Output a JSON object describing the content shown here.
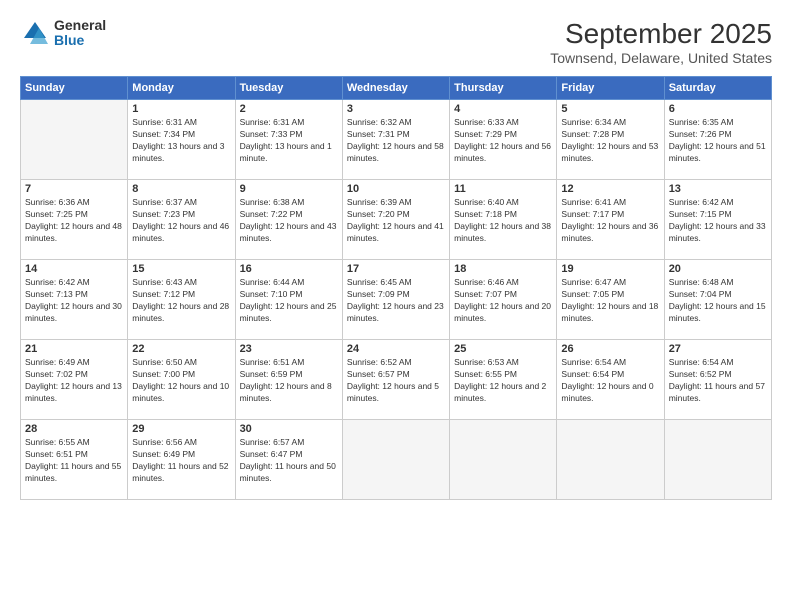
{
  "header": {
    "logo": {
      "general": "General",
      "blue": "Blue"
    },
    "title": "September 2025",
    "location": "Townsend, Delaware, United States"
  },
  "weekdays": [
    "Sunday",
    "Monday",
    "Tuesday",
    "Wednesday",
    "Thursday",
    "Friday",
    "Saturday"
  ],
  "weeks": [
    [
      {
        "day": "",
        "empty": true
      },
      {
        "day": "1",
        "sunrise": "Sunrise: 6:31 AM",
        "sunset": "Sunset: 7:34 PM",
        "daylight": "Daylight: 13 hours and 3 minutes."
      },
      {
        "day": "2",
        "sunrise": "Sunrise: 6:31 AM",
        "sunset": "Sunset: 7:33 PM",
        "daylight": "Daylight: 13 hours and 1 minute."
      },
      {
        "day": "3",
        "sunrise": "Sunrise: 6:32 AM",
        "sunset": "Sunset: 7:31 PM",
        "daylight": "Daylight: 12 hours and 58 minutes."
      },
      {
        "day": "4",
        "sunrise": "Sunrise: 6:33 AM",
        "sunset": "Sunset: 7:29 PM",
        "daylight": "Daylight: 12 hours and 56 minutes."
      },
      {
        "day": "5",
        "sunrise": "Sunrise: 6:34 AM",
        "sunset": "Sunset: 7:28 PM",
        "daylight": "Daylight: 12 hours and 53 minutes."
      },
      {
        "day": "6",
        "sunrise": "Sunrise: 6:35 AM",
        "sunset": "Sunset: 7:26 PM",
        "daylight": "Daylight: 12 hours and 51 minutes."
      }
    ],
    [
      {
        "day": "7",
        "sunrise": "Sunrise: 6:36 AM",
        "sunset": "Sunset: 7:25 PM",
        "daylight": "Daylight: 12 hours and 48 minutes."
      },
      {
        "day": "8",
        "sunrise": "Sunrise: 6:37 AM",
        "sunset": "Sunset: 7:23 PM",
        "daylight": "Daylight: 12 hours and 46 minutes."
      },
      {
        "day": "9",
        "sunrise": "Sunrise: 6:38 AM",
        "sunset": "Sunset: 7:22 PM",
        "daylight": "Daylight: 12 hours and 43 minutes."
      },
      {
        "day": "10",
        "sunrise": "Sunrise: 6:39 AM",
        "sunset": "Sunset: 7:20 PM",
        "daylight": "Daylight: 12 hours and 41 minutes."
      },
      {
        "day": "11",
        "sunrise": "Sunrise: 6:40 AM",
        "sunset": "Sunset: 7:18 PM",
        "daylight": "Daylight: 12 hours and 38 minutes."
      },
      {
        "day": "12",
        "sunrise": "Sunrise: 6:41 AM",
        "sunset": "Sunset: 7:17 PM",
        "daylight": "Daylight: 12 hours and 36 minutes."
      },
      {
        "day": "13",
        "sunrise": "Sunrise: 6:42 AM",
        "sunset": "Sunset: 7:15 PM",
        "daylight": "Daylight: 12 hours and 33 minutes."
      }
    ],
    [
      {
        "day": "14",
        "sunrise": "Sunrise: 6:42 AM",
        "sunset": "Sunset: 7:13 PM",
        "daylight": "Daylight: 12 hours and 30 minutes."
      },
      {
        "day": "15",
        "sunrise": "Sunrise: 6:43 AM",
        "sunset": "Sunset: 7:12 PM",
        "daylight": "Daylight: 12 hours and 28 minutes."
      },
      {
        "day": "16",
        "sunrise": "Sunrise: 6:44 AM",
        "sunset": "Sunset: 7:10 PM",
        "daylight": "Daylight: 12 hours and 25 minutes."
      },
      {
        "day": "17",
        "sunrise": "Sunrise: 6:45 AM",
        "sunset": "Sunset: 7:09 PM",
        "daylight": "Daylight: 12 hours and 23 minutes."
      },
      {
        "day": "18",
        "sunrise": "Sunrise: 6:46 AM",
        "sunset": "Sunset: 7:07 PM",
        "daylight": "Daylight: 12 hours and 20 minutes."
      },
      {
        "day": "19",
        "sunrise": "Sunrise: 6:47 AM",
        "sunset": "Sunset: 7:05 PM",
        "daylight": "Daylight: 12 hours and 18 minutes."
      },
      {
        "day": "20",
        "sunrise": "Sunrise: 6:48 AM",
        "sunset": "Sunset: 7:04 PM",
        "daylight": "Daylight: 12 hours and 15 minutes."
      }
    ],
    [
      {
        "day": "21",
        "sunrise": "Sunrise: 6:49 AM",
        "sunset": "Sunset: 7:02 PM",
        "daylight": "Daylight: 12 hours and 13 minutes."
      },
      {
        "day": "22",
        "sunrise": "Sunrise: 6:50 AM",
        "sunset": "Sunset: 7:00 PM",
        "daylight": "Daylight: 12 hours and 10 minutes."
      },
      {
        "day": "23",
        "sunrise": "Sunrise: 6:51 AM",
        "sunset": "Sunset: 6:59 PM",
        "daylight": "Daylight: 12 hours and 8 minutes."
      },
      {
        "day": "24",
        "sunrise": "Sunrise: 6:52 AM",
        "sunset": "Sunset: 6:57 PM",
        "daylight": "Daylight: 12 hours and 5 minutes."
      },
      {
        "day": "25",
        "sunrise": "Sunrise: 6:53 AM",
        "sunset": "Sunset: 6:55 PM",
        "daylight": "Daylight: 12 hours and 2 minutes."
      },
      {
        "day": "26",
        "sunrise": "Sunrise: 6:54 AM",
        "sunset": "Sunset: 6:54 PM",
        "daylight": "Daylight: 12 hours and 0 minutes."
      },
      {
        "day": "27",
        "sunrise": "Sunrise: 6:54 AM",
        "sunset": "Sunset: 6:52 PM",
        "daylight": "Daylight: 11 hours and 57 minutes."
      }
    ],
    [
      {
        "day": "28",
        "sunrise": "Sunrise: 6:55 AM",
        "sunset": "Sunset: 6:51 PM",
        "daylight": "Daylight: 11 hours and 55 minutes."
      },
      {
        "day": "29",
        "sunrise": "Sunrise: 6:56 AM",
        "sunset": "Sunset: 6:49 PM",
        "daylight": "Daylight: 11 hours and 52 minutes."
      },
      {
        "day": "30",
        "sunrise": "Sunrise: 6:57 AM",
        "sunset": "Sunset: 6:47 PM",
        "daylight": "Daylight: 11 hours and 50 minutes."
      },
      {
        "day": "",
        "empty": true
      },
      {
        "day": "",
        "empty": true
      },
      {
        "day": "",
        "empty": true
      },
      {
        "day": "",
        "empty": true
      }
    ]
  ]
}
